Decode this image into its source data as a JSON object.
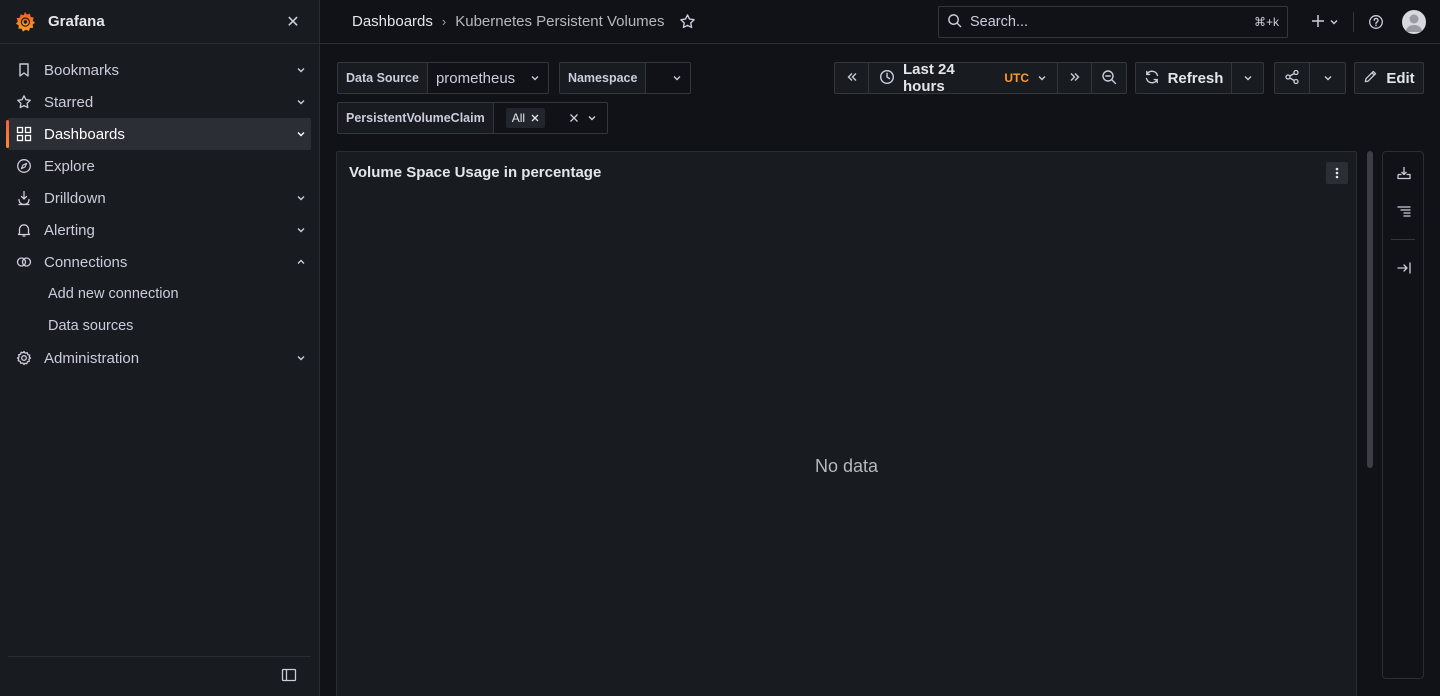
{
  "app": {
    "name": "Grafana"
  },
  "sidebar": {
    "items": [
      {
        "label": "Bookmarks",
        "icon": "bookmark-icon",
        "chevron": "down"
      },
      {
        "label": "Starred",
        "icon": "star-icon",
        "chevron": "down"
      },
      {
        "label": "Dashboards",
        "icon": "apps-grid-icon",
        "chevron": "down",
        "active": true
      },
      {
        "label": "Explore",
        "icon": "compass-icon"
      },
      {
        "label": "Drilldown",
        "icon": "drilldown-icon",
        "chevron": "down"
      },
      {
        "label": "Alerting",
        "icon": "bell-icon",
        "chevron": "down"
      },
      {
        "label": "Connections",
        "icon": "connections-icon",
        "chevron": "up"
      },
      {
        "label": "Add new connection",
        "sub": true
      },
      {
        "label": "Data sources",
        "sub": true
      },
      {
        "label": "Administration",
        "icon": "cog-icon",
        "chevron": "down"
      }
    ]
  },
  "topbar": {
    "breadcrumb": [
      "Dashboards",
      "Kubernetes Persistent Volumes"
    ],
    "search_placeholder": "Search...",
    "search_shortcut": "⌘+k"
  },
  "variables": {
    "datasource": {
      "label": "Data Source",
      "value": "prometheus"
    },
    "namespace": {
      "label": "Namespace",
      "value": ""
    },
    "pvc": {
      "label": "PersistentVolumeClaim",
      "value": "All"
    }
  },
  "time_picker": {
    "range": "Last 24 hours",
    "timezone": "UTC"
  },
  "toolbar": {
    "refresh_label": "Refresh",
    "edit_label": "Edit"
  },
  "panel": {
    "title": "Volume Space Usage in percentage",
    "empty_text": "No data"
  },
  "colors": {
    "accent": "#ff9830",
    "brand": "#f55f3e",
    "background": "#111217",
    "panel": "#181b1f"
  }
}
